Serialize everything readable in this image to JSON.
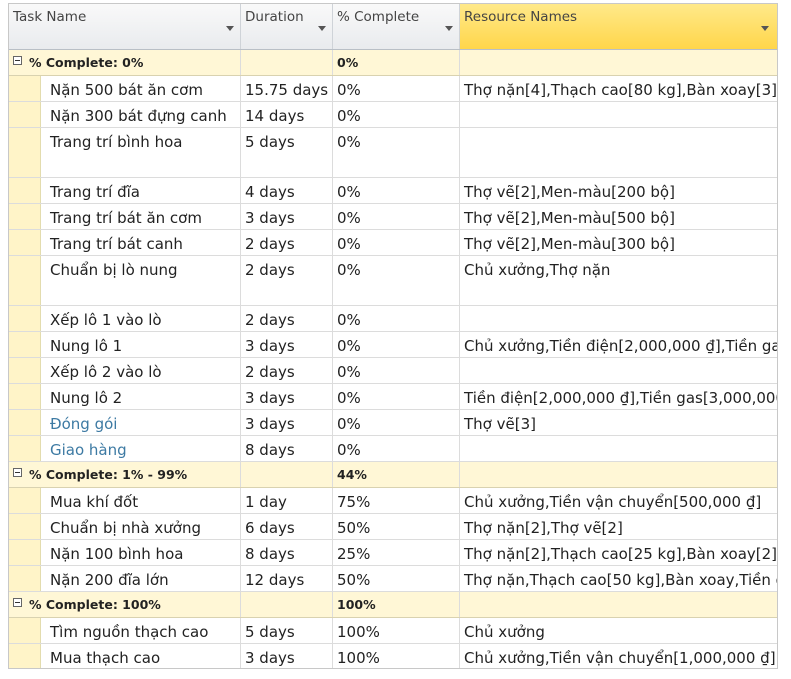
{
  "columns": {
    "task_name": "Task Name",
    "duration": "Duration",
    "percent_complete": "% Complete",
    "resource_names": "Resource Names"
  },
  "colors": {
    "group_bg": "#fff7d6",
    "header_highlight": "#ffd64a",
    "link_blue": "#3d7aa3"
  },
  "groups": [
    {
      "label": "% Complete: 0%",
      "percent": "0%"
    },
    {
      "label": "% Complete: 1% - 99%",
      "percent": "44%"
    },
    {
      "label": "% Complete: 100%",
      "percent": "100%"
    }
  ],
  "tasks": [
    {
      "name": "Nặn 500 bát ăn cơm",
      "duration": "15.75 days",
      "percent": "0%",
      "resources": "Thợ nặn[4],Thạch cao[80 kg],Bàn xoay[3],"
    },
    {
      "name": "Nặn 300 bát đựng canh",
      "duration": "14 days",
      "percent": "0%",
      "resources": ""
    },
    {
      "name": "Trang trí bình hoa",
      "duration": "5 days",
      "percent": "0%",
      "resources": ""
    },
    {
      "name": "Trang trí đĩa",
      "duration": "4 days",
      "percent": "0%",
      "resources": "Thợ vẽ[2],Men-màu[200 bộ]"
    },
    {
      "name": "Trang trí bát ăn cơm",
      "duration": "3 days",
      "percent": "0%",
      "resources": "Thợ vẽ[2],Men-màu[500 bộ]"
    },
    {
      "name": "Trang trí bát canh",
      "duration": "2 days",
      "percent": "0%",
      "resources": "Thợ vẽ[2],Men-màu[300 bộ]"
    },
    {
      "name": "Chuẩn bị lò nung",
      "duration": "2 days",
      "percent": "0%",
      "resources": "Chủ xưởng,Thợ nặn"
    },
    {
      "name": "Xếp lô 1 vào lò",
      "duration": "2 days",
      "percent": "0%",
      "resources": ""
    },
    {
      "name": "Nung lô 1",
      "duration": "3 days",
      "percent": "0%",
      "resources": "Chủ xưởng,Tiền điện[2,000,000 ₫],Tiền ga"
    },
    {
      "name": "Xếp lô 2 vào lò",
      "duration": "2 days",
      "percent": "0%",
      "resources": ""
    },
    {
      "name": "Nung lô 2",
      "duration": "3 days",
      "percent": "0%",
      "resources": "Tiền điện[2,000,000 ₫],Tiền gas[3,000,000"
    },
    {
      "name": "Đóng gói",
      "duration": "3 days",
      "percent": "0%",
      "resources": "Thợ vẽ[3]"
    },
    {
      "name": "Giao hàng",
      "duration": "8 days",
      "percent": "0%",
      "resources": ""
    },
    {
      "name": "Mua khí đốt",
      "duration": "1 day",
      "percent": "75%",
      "resources": "Chủ xưởng,Tiền vận chuyển[500,000 ₫]"
    },
    {
      "name": "Chuẩn bị nhà xưởng",
      "duration": "6 days",
      "percent": "50%",
      "resources": "Thợ nặn[2],Thợ vẽ[2]"
    },
    {
      "name": "Nặn 100 bình hoa",
      "duration": "8 days",
      "percent": "25%",
      "resources": "Thợ nặn[2],Thạch cao[25 kg],Bàn xoay[2],"
    },
    {
      "name": "Nặn 200 đĩa lớn",
      "duration": "12 days",
      "percent": "50%",
      "resources": "Thợ nặn,Thạch cao[50 kg],Bàn xoay,Tiền đ"
    },
    {
      "name": "Tìm nguồn thạch cao",
      "duration": "5 days",
      "percent": "100%",
      "resources": "Chủ xưởng"
    },
    {
      "name": "Mua thạch cao",
      "duration": "3 days",
      "percent": "100%",
      "resources": "Chủ xưởng,Tiền vận chuyển[1,000,000 ₫]"
    }
  ]
}
